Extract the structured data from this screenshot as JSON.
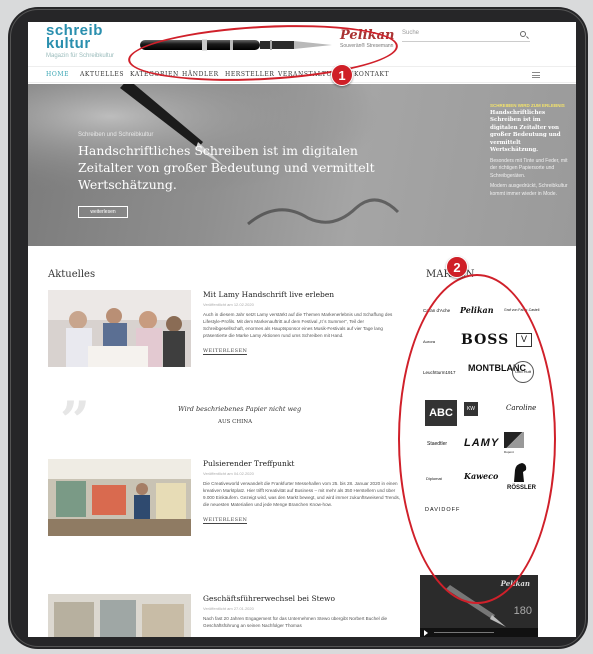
{
  "header": {
    "logo": "schreib",
    "logo_line2": "kultur",
    "logo_sub": "Magazin für Schreibkultur",
    "brand_name": "Pelikan",
    "brand_sub": "Souverän® Stresemann",
    "search_placeholder": "Suche"
  },
  "nav": {
    "items": [
      "HOME",
      "AKTUELLES",
      "KATEGORIEN",
      "HÄNDLER",
      "HERSTELLER",
      "VERANSTALTUNGEN",
      "KONTAKT"
    ]
  },
  "hero": {
    "eyebrow": "Schreiben und Schreibkultur",
    "title": "Handschriftliches Schreiben ist im digitalen Zeitalter von großer Bedeutung und vermittelt Wertschätzung.",
    "button": "weiterlesen",
    "side_title": "SCHREIBEN WIRD ZUM ERLEBNIS",
    "side_lead": "Handschriftliches Schreiben ist im digitalen Zeitalter von großer Bedeutung und vermittelt Wertschätzung.",
    "side_text1": "Besonders mit Tinte und Feder, mit der richtigen Papiersorte und Schreibgeräten.",
    "side_text2": "Modern ausgedrückt, Schreibkultur kommt immer wieder in Mode."
  },
  "news": {
    "title": "Aktuelles",
    "articles": [
      {
        "title": "Mit Lamy Handschrift live erleben",
        "date": "Veröffentlicht am 12.02.2020",
        "text": "Auch in diesem Jahr setzt Lamy verstärkt auf die Themen Markenerlebnis und Schaffung des Lifestyle-Profils. Mit dem Markenauftritt auf dem Festival „It`s Summer“, Teil der Schreibgesellschaft, enormes als Hauptsponsor eines Musik-Festivals auf vier Tage lang präsentierte die Marke Lamy Aktionen rund ums Schreiben mit Hand.",
        "more": "WEITERLESEN"
      },
      {
        "title": "Pulsierender Treffpunkt",
        "date": "Veröffentlicht am 04.02.2020",
        "text": "Die Creativeworld verwandelt die Frankfurter Messehallen vom 25. bis 28. Januar 2020 in einen kreativen Marktplatz. Hier trifft Kreativität auf Business – mit mehr als 350 Herstellern und über 9.000 Einkäufern. Gezeigt wird, was den Markt bewegt, und wird immer zukunftsweisend Trends, die neuesten Materialien und jede Menge Branchen Know-how.",
        "more": "WEITERLESEN"
      },
      {
        "title": "Geschäftsführerwechsel bei Stewo",
        "date": "Veröffentlicht am 27.01.2020",
        "text": "Nach fast 20 Jahren Engagement für das Unternehmen Stewo übergibt Norbert Buchel die Geschäftsführung an seinen Nachfolger Thomas"
      }
    ]
  },
  "quote": {
    "text": "Wird beschriebenes Papier nicht weg",
    "source": "AUS CHINA"
  },
  "brands": {
    "title": "MARKEN",
    "items": [
      "Caran d'Ache",
      "Pelikan",
      "Graf von Faber-Castell",
      "Aurora",
      "BOSS",
      "Visconti",
      "Leuchtturm1917",
      "MONTBLANC",
      "Otto Hutt",
      "ABC",
      "KW",
      "Caroline",
      "Staedtler",
      "LAMY",
      "Dupont",
      "Kaweco",
      "Diplomat",
      "RÖSSLER",
      "DAVIDOFF"
    ]
  },
  "video": {
    "brand": "Pelikan",
    "number": "180"
  },
  "annotations": {
    "badge1": "1",
    "badge2": "2",
    "color": "#d0202a"
  }
}
